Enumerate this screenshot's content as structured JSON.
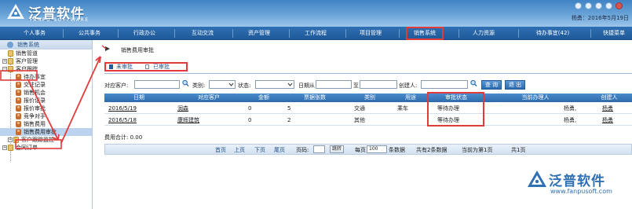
{
  "header": {
    "logo_cn": "泛普软件",
    "logo_en": "FANPU SOFTWARE",
    "user_info": "杨勇：2016年5月19日"
  },
  "nav": {
    "items": [
      {
        "label": "个人事务"
      },
      {
        "label": "公共事务"
      },
      {
        "label": "行政办公"
      },
      {
        "label": "互动交流"
      },
      {
        "label": "资产管理"
      },
      {
        "label": "工作流程"
      },
      {
        "label": "项目管理"
      },
      {
        "label": "销售系统",
        "active": true
      },
      {
        "label": "人力资源"
      },
      {
        "label": "待办事宜(42)"
      },
      {
        "label": "快捷菜单"
      }
    ]
  },
  "sidebar": {
    "title": "销售系统",
    "items": [
      {
        "label": "销售管道"
      },
      {
        "label": "客户管理"
      },
      {
        "label": "客户跟踪"
      },
      {
        "label": "待办事宜"
      },
      {
        "label": "交往记录"
      },
      {
        "label": "销售机会"
      },
      {
        "label": "报价记录"
      },
      {
        "label": "报价审批"
      },
      {
        "label": "竞争对手"
      },
      {
        "label": "销售费用"
      },
      {
        "label": "销售费用审批"
      },
      {
        "label": "客户跟踪监控"
      },
      {
        "label": "合同订单"
      }
    ]
  },
  "main": {
    "breadcrumb": "销售费用审批",
    "tabs": [
      {
        "label": "未审批"
      },
      {
        "label": "已审批"
      }
    ],
    "filter": {
      "customer_label": "对应客户:",
      "type_label": "类别:",
      "status_label": "状态:",
      "date_from_label": "日期从",
      "date_to_label": "至",
      "creator_label": "创建人:",
      "search_button": "查 询",
      "back_button": "退 出"
    },
    "table": {
      "columns": [
        "日期",
        "对应客户",
        "金额",
        "票据张数",
        "类别",
        "用途",
        "审批状态",
        "当前办理人",
        "创建人"
      ],
      "rows": [
        {
          "date": "2016/5/19",
          "customer": "润森",
          "amount": "0",
          "tickets": "5",
          "type": "交通",
          "purpose": "乘车",
          "status": "等待办理",
          "handler": "杨勇,",
          "creator": "杨勇"
        },
        {
          "date": "2016/5/18",
          "customer": "康辉建筑",
          "amount": "0",
          "tickets": "2",
          "type": "其他",
          "purpose": "",
          "status": "等待办理",
          "handler": "杨勇,",
          "creator": "杨勇"
        }
      ]
    },
    "total": "费用合计: 0.00",
    "pager": {
      "first": "首页",
      "prev": "上页",
      "next": "下页",
      "last": "尾页",
      "page_label": "页码:",
      "jump": "跳转",
      "per_page_label": "每页",
      "per_page_value": "100",
      "per_page_suffix": "条数据",
      "total_records": "共有2条数据",
      "current_page": "当前为第1页",
      "total_pages": "共1页"
    }
  },
  "watermark": {
    "cn": "泛普软件",
    "url": "www.fanpusoft.com"
  },
  "colors": {
    "nav_bg": "#1f5a99",
    "header_bg": "#3f83c4",
    "highlight": "#e23b3b",
    "table_head": "#2c6aab"
  }
}
